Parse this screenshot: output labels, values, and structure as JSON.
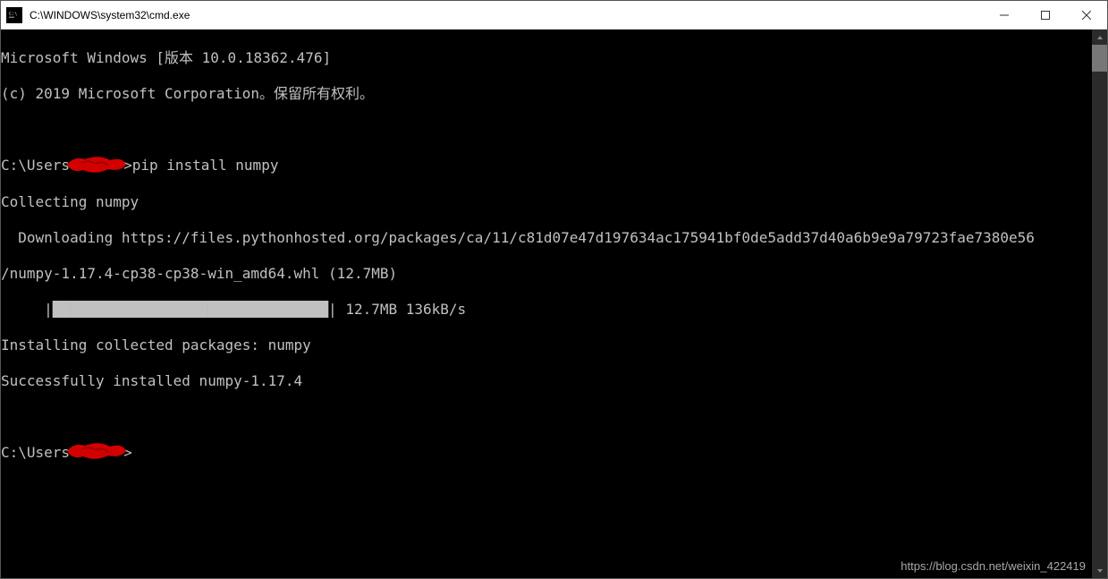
{
  "window": {
    "title": "C:\\WINDOWS\\system32\\cmd.exe"
  },
  "terminal": {
    "line1": "Microsoft Windows [版本 10.0.18362.476]",
    "line2": "(c) 2019 Microsoft Corporation。保留所有权利。",
    "prompt1_prefix": "C:\\Users",
    "prompt1_suffix": ">pip install numpy",
    "line4": "Collecting numpy",
    "line5": "  Downloading https://files.pythonhosted.org/packages/ca/11/c81d07e47d197634ac175941bf0de5add37d40a6b9e9a79723fae7380e56",
    "line6": "/numpy-1.17.4-cp38-cp38-win_amd64.whl (12.7MB)",
    "progress_prefix": "     |",
    "progress_blocks": "████████████████████████████████",
    "progress_suffix": "| 12.7MB 136kB/s",
    "line8": "Installing collected packages: numpy",
    "line9": "Successfully installed numpy-1.17.4",
    "prompt2_prefix": "C:\\Users",
    "prompt2_suffix": ">"
  },
  "watermark": "https://blog.csdn.net/weixin_422419"
}
